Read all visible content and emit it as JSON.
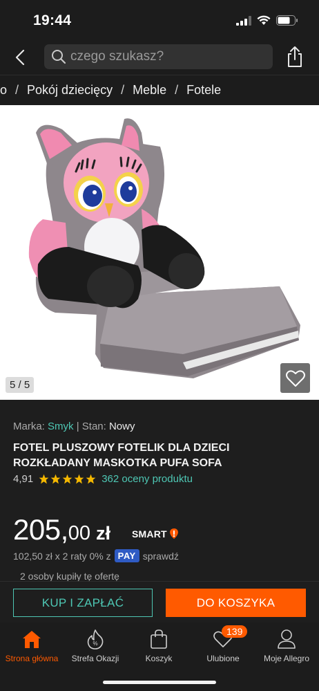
{
  "status_bar": {
    "time": "19:44"
  },
  "search": {
    "placeholder": "czego szukasz?"
  },
  "breadcrumb": [
    "o",
    "Pokój dziecięcy",
    "Meble",
    "Fotele"
  ],
  "gallery": {
    "counter": "5 / 5"
  },
  "product": {
    "brand_label": "Marka:",
    "brand": "Smyk",
    "condition_label": "Stan:",
    "condition": "Nowy",
    "title": "FOTEL PLUSZOWY FOTELIK DLA DZIECI ROZKŁADANY MASKOTKA PUFA SOFA",
    "rating": "4,91",
    "stars": 5,
    "rating_count": "362 oceny produktu",
    "price_main": "205,",
    "price_cents": "00",
    "currency": "zł",
    "smart": "SMART",
    "installments": "102,50 zł x 2 raty 0% z",
    "pay_badge": "PAY",
    "check": "sprawdź",
    "bought": "2 osoby kupiły tę ofertę"
  },
  "actions": {
    "buy_now": "KUP I ZAPŁAĆ",
    "add_to_cart": "DO KOSZYKA"
  },
  "nav": {
    "home": "Strona główna",
    "deals": "Strefa Okazji",
    "cart": "Koszyk",
    "favorites": "Ulubione",
    "favorites_badge": "139",
    "my": "Moje Allegro"
  },
  "colors": {
    "accent": "#ff5a00",
    "teal": "#4ec7b4",
    "pay": "#2f5bc4",
    "star": "#f5b800"
  }
}
